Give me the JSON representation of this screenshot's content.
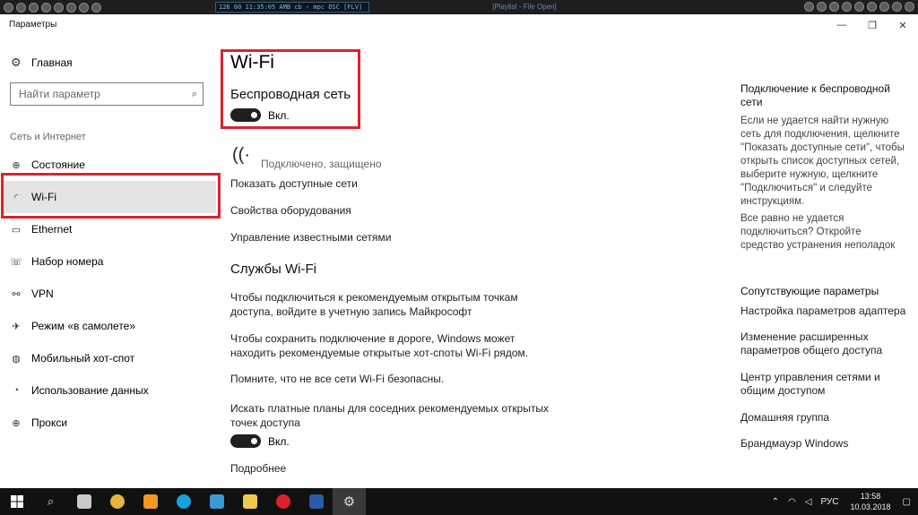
{
  "player": {
    "lcd": "126     00     11:35:05   AMB cb ‹ mpc     OSC [FLV]",
    "title": "[Playlist - File Open]"
  },
  "window": {
    "title": "Параметры",
    "minimize": "—",
    "maximize": "❐",
    "close": "✕"
  },
  "sidebar": {
    "home": "Главная",
    "search_placeholder": "Найти параметр",
    "section": "Сеть и Интернет",
    "items": [
      {
        "label": "Состояние",
        "icon": "⊕"
      },
      {
        "label": "Wi-Fi",
        "icon": "◜"
      },
      {
        "label": "Ethernet",
        "icon": "▭"
      },
      {
        "label": "Набор номера",
        "icon": "☏"
      },
      {
        "label": "VPN",
        "icon": "⚯"
      },
      {
        "label": "Режим «в самолете»",
        "icon": "✈"
      },
      {
        "label": "Мобильный хот-спот",
        "icon": "◍"
      },
      {
        "label": "Использование данных",
        "icon": "◔"
      },
      {
        "label": "Прокси",
        "icon": "⊕"
      }
    ]
  },
  "main": {
    "title": "Wi-Fi",
    "wireless_heading": "Беспроводная сеть",
    "toggle1_label": "Вкл.",
    "network_status": "Подключено, защищено",
    "links": [
      "Показать доступные сети",
      "Свойства оборудования",
      "Управление известными сетями"
    ],
    "services_heading": "Службы Wi-Fi",
    "para1_l1": "Чтобы подключиться к рекомендуемым открытым точкам",
    "para1_l2": "доступа, войдите в учетную запись Майкрософт",
    "para2_l1": "Чтобы сохранить подключение в дороге, Windows может",
    "para2_l2": "находить рекомендуемые открытые хот-споты Wi-Fi рядом.",
    "para3": "Помните, что не все сети Wi-Fi безопасны.",
    "para4_l1": "Искать платные планы для соседних рекомендуемых открытых",
    "para4_l2": "точек доступа",
    "toggle2_label": "Вкл.",
    "more": "Подробнее"
  },
  "right": {
    "head1_l1": "Подключение к беспроводной",
    "head1_l2": "сети",
    "txt1": [
      "Если не удается найти нужную",
      "сеть для подключения, щелкните",
      "\"Показать доступные сети\", чтобы",
      "открыть список доступных сетей,",
      "выберите нужную, щелкните",
      "\"Подключиться\" и следуйте",
      "инструкциям."
    ],
    "txt2": [
      "Все равно не удается",
      "подключиться? Откройте",
      "средство устранения неполадок"
    ],
    "head2": "Сопутствующие параметры",
    "links": [
      [
        "Настройка параметров адаптера"
      ],
      [
        "Изменение расширенных",
        "параметров общего доступа"
      ],
      [
        "Центр управления сетями и",
        "общим доступом"
      ],
      [
        "Домашняя группа"
      ],
      [
        "Брандмауэр Windows"
      ]
    ]
  },
  "taskbar": {
    "lang": "РУС",
    "time": "13:58",
    "date": "10.03.2018"
  }
}
